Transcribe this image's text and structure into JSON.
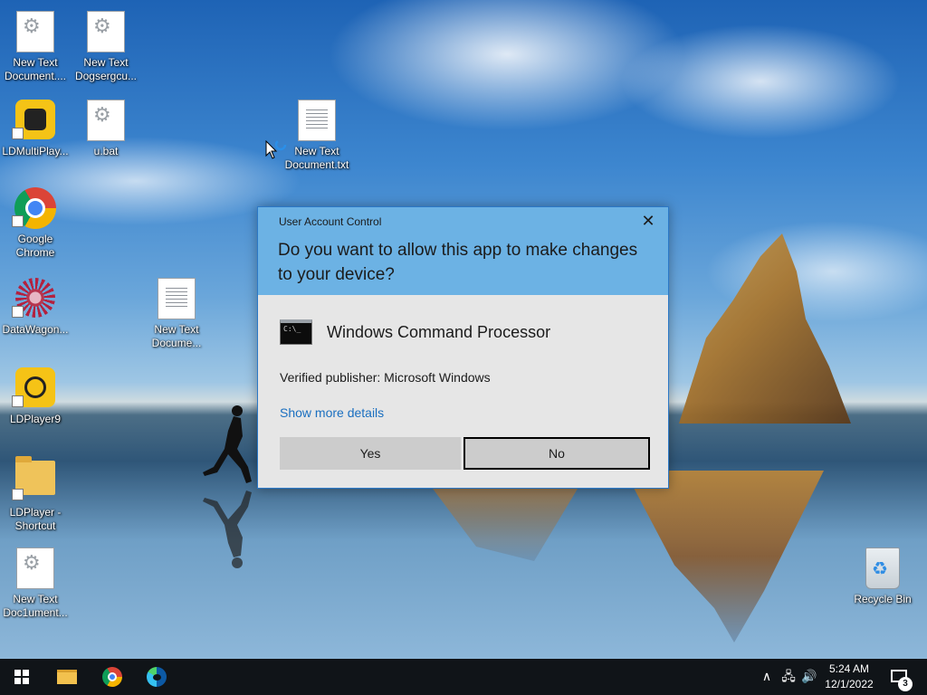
{
  "desktop": {
    "icons": [
      {
        "label": "New Text\nDocument...."
      },
      {
        "label": "New Text\nDogsergcu..."
      },
      {
        "label": "LDMultiPlay..."
      },
      {
        "label": "u.bat"
      },
      {
        "label": "New Text\nDocument.txt"
      },
      {
        "label": "Google\nChrome"
      },
      {
        "label": "DataWagon..."
      },
      {
        "label": "New Text\nDocume..."
      },
      {
        "label": "LDPlayer9"
      },
      {
        "label": "LDPlayer -\nShortcut"
      },
      {
        "label": "New Text\nDoc1ument..."
      },
      {
        "label": "Recycle Bin"
      }
    ]
  },
  "dialog": {
    "caption": "User Account Control",
    "close_glyph": "✕",
    "question": "Do you want to allow this app to make changes to your device?",
    "app_name": "Windows Command Processor",
    "publisher": "Verified publisher: Microsoft Windows",
    "details_link": "Show more details",
    "yes_label": "Yes",
    "no_label": "No"
  },
  "taskbar": {
    "tray_chevron": "∧",
    "tray_network": "🖧",
    "tray_volume": "🔊",
    "time": "5:24 AM",
    "date": "12/1/2022",
    "notification_count": "3"
  }
}
